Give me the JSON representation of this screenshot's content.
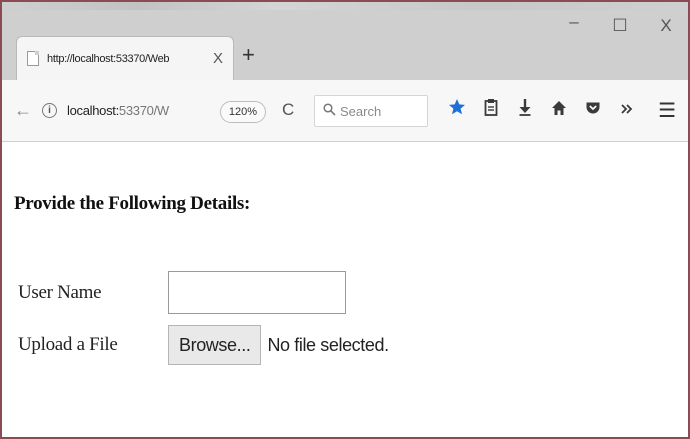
{
  "browser": {
    "tab": {
      "title": "http://localhost:53370/Web",
      "close": "X"
    },
    "new_tab": "+",
    "window_controls": {
      "minimize": "–",
      "maximize": "☐",
      "close": "X"
    },
    "nav": {
      "back": "←",
      "info": "i",
      "url_host": "localhost:",
      "url_rest": "53370/W",
      "zoom": "120%",
      "reload": "C",
      "search_placeholder": "Search",
      "menu": "☰"
    },
    "icons": {
      "bookmark": "star-icon",
      "reading_list": "clipboard-icon",
      "downloads": "download-icon",
      "home": "home-icon",
      "pocket": "pocket-icon",
      "overflow": "overflow-icon",
      "menu": "hamburger-icon"
    },
    "accent_color": "#1e6fd6"
  },
  "page": {
    "heading": "Provide the Following Details:",
    "form": {
      "username_label": "User Name",
      "username_value": "",
      "upload_label": "Upload a File",
      "browse_label": "Browse...",
      "file_status": "No file selected."
    }
  }
}
